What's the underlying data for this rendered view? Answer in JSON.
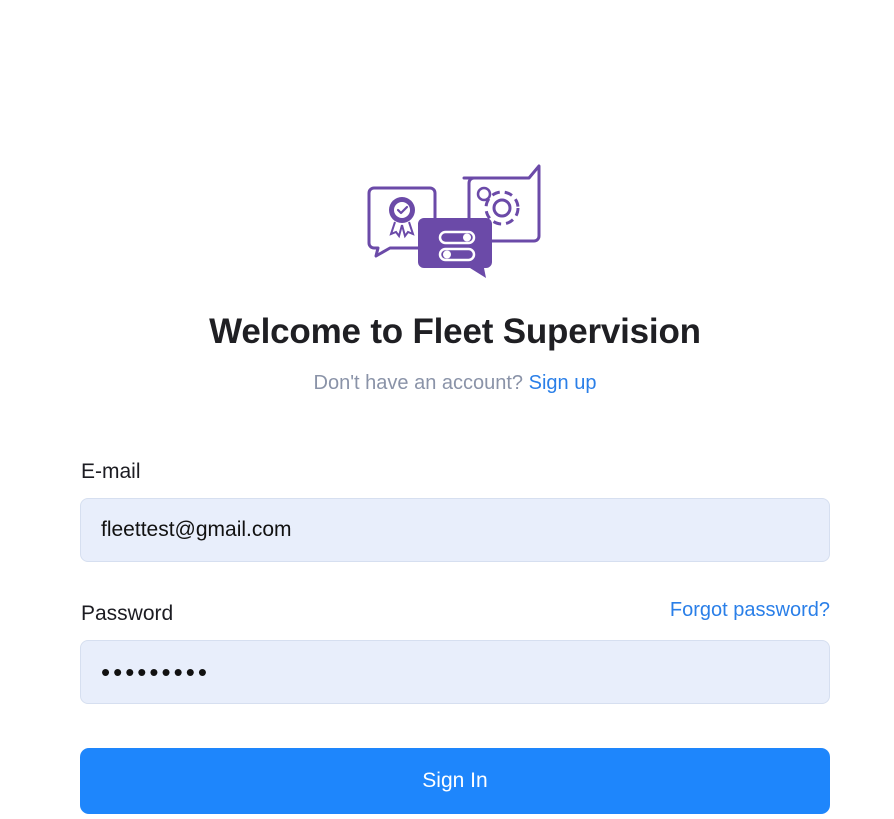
{
  "header": {
    "title": "Welcome to Fleet Supervision",
    "subtitle_prefix": "Don't have an account?",
    "signup_label": "Sign up"
  },
  "form": {
    "email_label": "E-mail",
    "email_value": "fleettest@gmail.com",
    "password_label": "Password",
    "password_masked": "•••••••••",
    "forgot_label": "Forgot password?",
    "signin_label": "Sign In"
  },
  "logo": {
    "icon_name": "chat-bubbles-settings-logo",
    "color": "#6b4aa8"
  },
  "colors": {
    "accent": "#1e86fc",
    "link": "#2a7fe8",
    "input_background": "#e8eefb"
  }
}
